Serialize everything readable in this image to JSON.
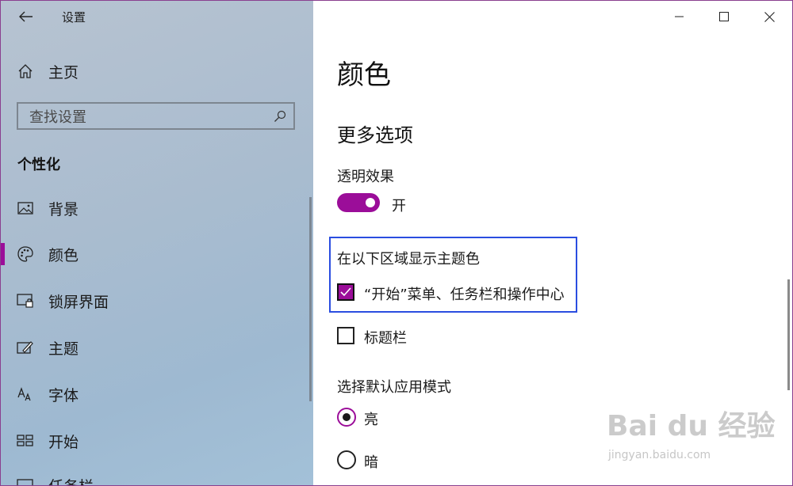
{
  "window": {
    "app_title": "设置",
    "controls": {
      "minimize": "minimize",
      "maximize": "maximize",
      "close": "close"
    }
  },
  "sidebar": {
    "home_label": "主页",
    "search": {
      "placeholder": "查找设置",
      "value": ""
    },
    "section_heading": "个性化",
    "items": [
      {
        "label": "背景",
        "icon": "image-icon",
        "active": false
      },
      {
        "label": "颜色",
        "icon": "palette-icon",
        "active": true
      },
      {
        "label": "锁屏界面",
        "icon": "lock-screen-icon",
        "active": false
      },
      {
        "label": "主题",
        "icon": "theme-brush-icon",
        "active": false
      },
      {
        "label": "字体",
        "icon": "font-icon",
        "active": false
      },
      {
        "label": "开始",
        "icon": "start-icon",
        "active": false
      },
      {
        "label": "任务栏",
        "icon": "taskbar-icon",
        "active": false
      }
    ]
  },
  "content": {
    "page_title": "颜色",
    "subheading": "更多选项",
    "transparency": {
      "label": "透明效果",
      "state_text": "开",
      "on": true
    },
    "accent_surfaces": {
      "label": "在以下区域显示主题色",
      "options": [
        {
          "label": "“开始”菜单、任务栏和操作中心",
          "checked": true
        },
        {
          "label": "标题栏",
          "checked": false
        }
      ]
    },
    "app_mode": {
      "label": "选择默认应用模式",
      "options": [
        {
          "label": "亮",
          "selected": true
        },
        {
          "label": "暗",
          "selected": false
        }
      ]
    }
  },
  "watermark": {
    "logo_text": "Bai du 经验",
    "url": "jingyan.baidu.com"
  },
  "colors": {
    "accent": "#9b0d99",
    "highlight_border": "#2a4de0",
    "sidebar_bg": "#a9bccf"
  }
}
